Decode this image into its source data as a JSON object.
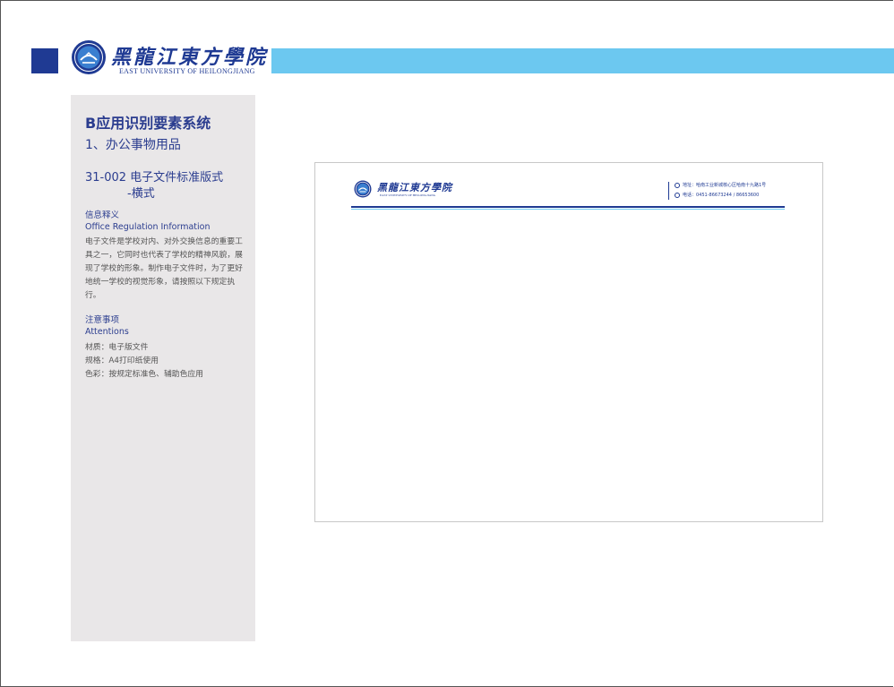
{
  "brand": {
    "school_cn": "黑龍江東方學院",
    "school_en": "EAST UNIVERSITY OF HEILONGJIANG",
    "primary_color": "#1f3a93",
    "accent_color": "#6cc8f0"
  },
  "sidebar": {
    "title": "B应用识别要素系统",
    "subtitle": "1、办公事物用品",
    "code_line1": "31-002 电子文件标准版式",
    "code_line2": "-横式",
    "info_heading_cn": "信息释义",
    "info_heading_en": "Office Regulation Information",
    "info_body": "电子文件是学校对内、对外交换信息的重要工具之一，它同时也代表了学校的精神风貌，展现了学校的形象。制作电子文件时，为了更好地统一学校的视觉形象，请按照以下规定执行。",
    "attn_heading_cn": "注意事项",
    "attn_heading_en": "Attentions",
    "attn_items": [
      "材质：电子版文件",
      "规格：A4打印纸使用",
      "色彩：按规定标准色、辅助色应用"
    ]
  },
  "document": {
    "school_cn": "黑龍江東方學院",
    "school_en": "EAST UNIVERSITY OF HEILONGJIANG",
    "address": "地址：哈南工业新城核心区哈南十九路1号",
    "phone": "电话：0451-86673244 / 86653600"
  },
  "icons": {
    "emblem": "school-emblem-icon",
    "address": "location-icon",
    "phone": "phone-icon"
  }
}
